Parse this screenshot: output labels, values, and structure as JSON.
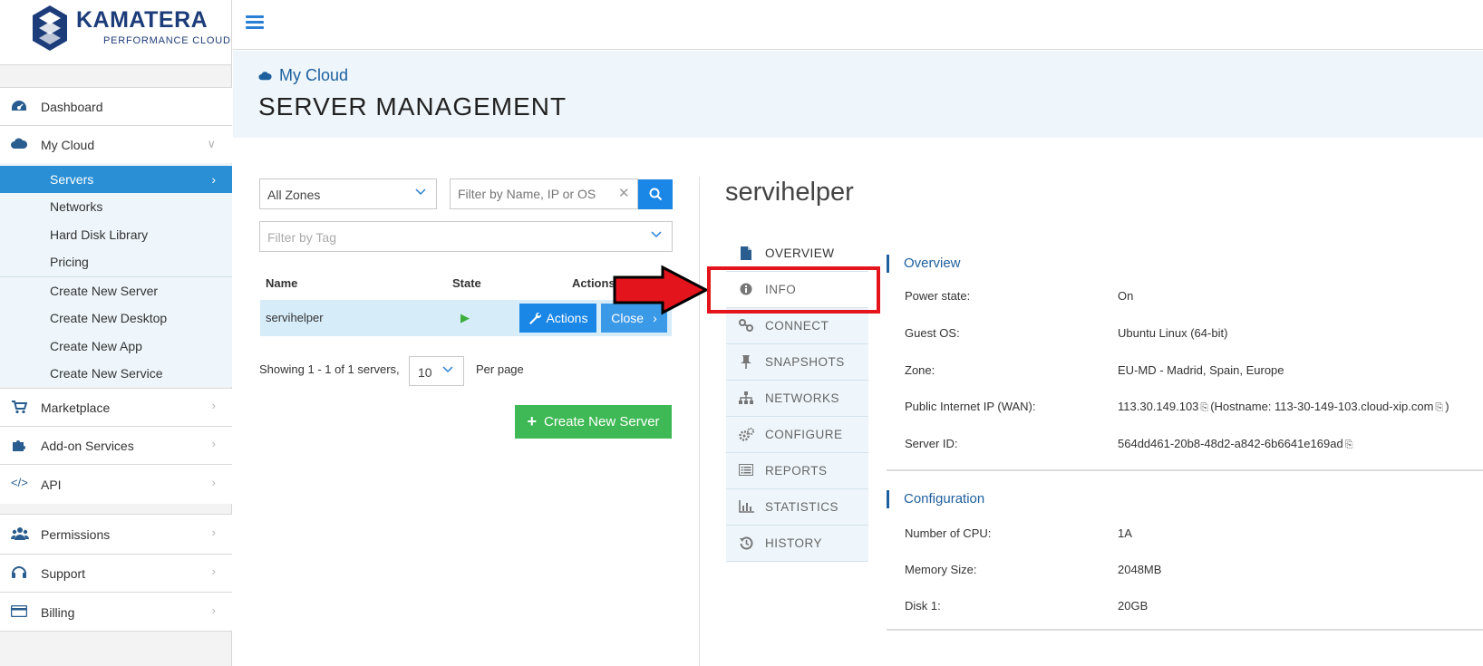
{
  "brand": {
    "name": "KAMATERA",
    "tagline": "PERFORMANCE CLOUD"
  },
  "sidebar": {
    "top_items": [
      {
        "label": "Dashboard",
        "icon": "dashboard-icon"
      },
      {
        "label": "My Cloud",
        "icon": "cloud-icon"
      }
    ],
    "submenu": [
      {
        "label": "Servers",
        "active": true
      },
      {
        "label": "Networks"
      },
      {
        "label": "Hard Disk Library"
      },
      {
        "label": "Pricing"
      },
      {
        "label": "Create New Server"
      },
      {
        "label": "Create New Desktop"
      },
      {
        "label": "Create New App"
      },
      {
        "label": "Create New Service"
      }
    ],
    "bottom_items": [
      {
        "label": "Marketplace",
        "icon": "cart-icon"
      },
      {
        "label": "Add-on Services",
        "icon": "puzzle-icon"
      },
      {
        "label": "API",
        "icon": "code-icon"
      },
      {
        "label": "Permissions",
        "icon": "users-icon"
      },
      {
        "label": "Support",
        "icon": "headset-icon"
      },
      {
        "label": "Billing",
        "icon": "credit-card-icon"
      }
    ]
  },
  "header": {
    "breadcrumb": "My Cloud",
    "title": "SERVER MANAGEMENT"
  },
  "filters": {
    "zone": "All Zones",
    "search_placeholder": "Filter by Name, IP or OS",
    "tag_placeholder": "Filter by Tag"
  },
  "table": {
    "headers": {
      "name": "Name",
      "state": "State",
      "actions": "Actions"
    },
    "rows": [
      {
        "name": "servihelper",
        "actions_label": "Actions",
        "close_label": "Close"
      }
    ]
  },
  "pagination": {
    "showing": "Showing 1 - 1 of 1 servers,",
    "per_page_value": "10",
    "per_page_label": "Per page"
  },
  "create_button": "Create New Server",
  "server": {
    "name": "servihelper",
    "tabs": [
      "OVERVIEW",
      "INFO",
      "CONNECT",
      "SNAPSHOTS",
      "NETWORKS",
      "CONFIGURE",
      "REPORTS",
      "STATISTICS",
      "HISTORY"
    ],
    "overview": {
      "heading": "Overview",
      "power_state_label": "Power state:",
      "power_state": "On",
      "guest_os_label": "Guest OS:",
      "guest_os": "Ubuntu Linux (64-bit)",
      "zone_label": "Zone:",
      "zone": "EU-MD - Madrid, Spain, Europe",
      "ip_label": "Public Internet IP (WAN):",
      "ip": "113.30.149.103",
      "hostname_prefix": "(Hostname:",
      "hostname": "113-30-149-103.cloud-xip.com",
      "hostname_suffix": ")",
      "server_id_label": "Server ID:",
      "server_id": "564dd461-20b8-48d2-a842-6b6641e169ad"
    },
    "configuration": {
      "heading": "Configuration",
      "cpu_label": "Number of CPU:",
      "cpu": "1A",
      "memory_label": "Memory Size:",
      "memory": "2048MB",
      "disk_label": "Disk 1:",
      "disk": "20GB"
    }
  },
  "colors": {
    "primary": "#1a87e6",
    "active_nav": "#2a8fd4",
    "success": "#3fb955",
    "highlight": "#e3141b",
    "header_bg": "#eef6fb"
  }
}
